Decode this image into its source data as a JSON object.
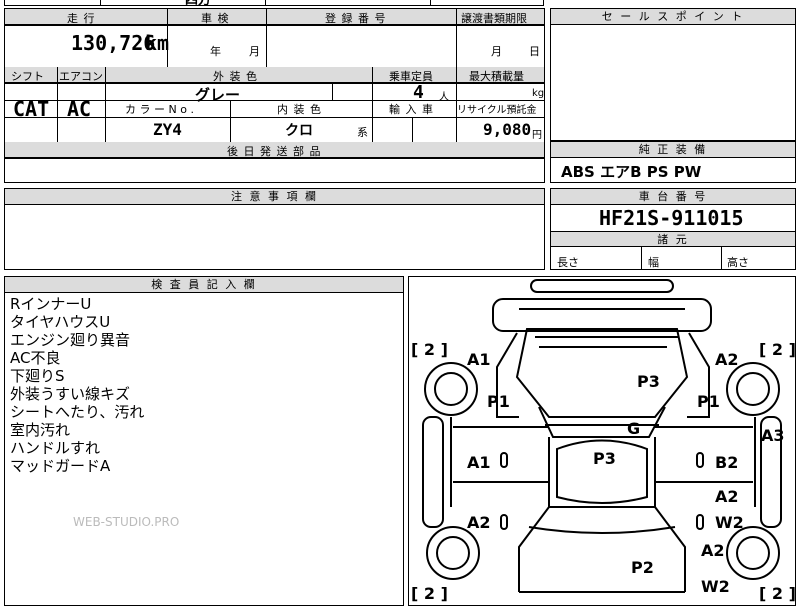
{
  "top_fragment": "四方",
  "left_table": {
    "headers": {
      "mileage": "走 行",
      "inspection": "車 検",
      "registration_no": "登 録 番 号",
      "transfer_docs_deadline": "譲渡書類期限",
      "shift": "シフト",
      "aircon": "エアコン",
      "exterior_color": "外 装 色",
      "capacity": "乗車定員",
      "max_load": "最大積載量",
      "color_no": "カ ラ ー N o .",
      "interior_color": "内 装 色",
      "import": "輸 入 車",
      "recycle_deposit": "リサイクル預託金",
      "later_parts": "後 日 発 送 部 品"
    },
    "mileage_value": "130,726",
    "mileage_unit": "km",
    "inspection_year": "年",
    "inspection_month": "月",
    "transfer_month": "月",
    "transfer_day": "日",
    "shift_value": "CAT",
    "aircon_value": "AC",
    "exterior_value": "グレー",
    "capacity_value": "4",
    "capacity_unit": "人",
    "max_load_unit": "kg",
    "color_no_value": "ZY4",
    "interior_value": "クロ",
    "interior_suffix": "系",
    "recycle_value": "9,080",
    "recycle_unit": "円"
  },
  "sales_point": {
    "header": "セ ー ル ス ポ イ ン ト"
  },
  "standard_equipment": {
    "header": "純 正 装 備",
    "value": "ABS エアB PS PW"
  },
  "caution": {
    "header": "注 意 事 項 欄"
  },
  "chassis": {
    "header": "車 台 番 号",
    "value": "HF21S-911015"
  },
  "specs": {
    "header": "諸 元",
    "length": "長さ",
    "width": "幅",
    "height": "高さ"
  },
  "inspector": {
    "header": "検 査 員 記 入 欄",
    "notes": [
      "RインナーU",
      "タイヤハウスU",
      "エンジン廻り異音",
      "AC不良",
      "下廻りS",
      "外装うすい線キズ",
      "シートへたり、汚れ",
      "室内汚れ",
      "ハンドルすれ",
      "マッドガードA"
    ],
    "watermark": "WEB-STUDIO.PRO"
  },
  "diagram": {
    "bracket_tl": "[ 2 ]",
    "bracket_tr": "[ 2 ]",
    "bracket_bl": "[ 2 ]",
    "bracket_br": "[ 2 ]",
    "marks": {
      "a1_front_left": "A1",
      "a2_front_right": "A2",
      "p3_hood": "P3",
      "p1_left": "P1",
      "p1_right": "P1",
      "a3_right": "A3",
      "g_windshield": "G",
      "a1_door_left": "A1",
      "p3_roof": "P3",
      "b2_right": "B2",
      "a2_rear_door_right": "A2",
      "a2_rear_left": "A2",
      "w2_right": "W2",
      "a2_rear_right": "A2",
      "p2_rear": "P2",
      "w2_rear": "W2"
    }
  }
}
